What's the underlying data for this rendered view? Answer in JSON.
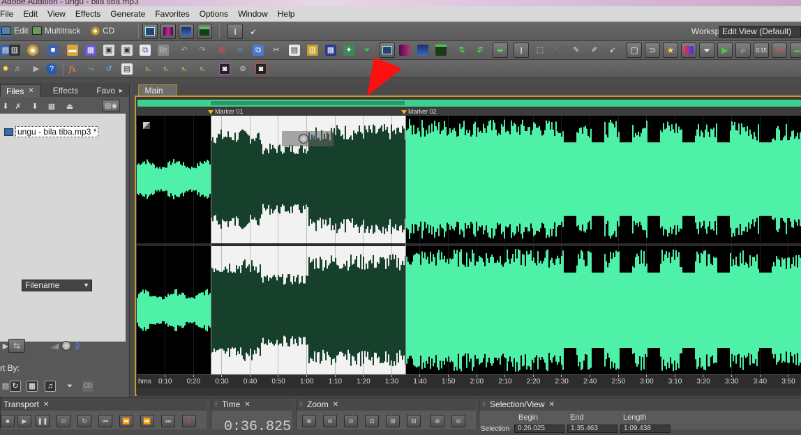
{
  "window": {
    "title": "Adobe Audition - ungu - bila tiba.mp3"
  },
  "menu": [
    "File",
    "Edit",
    "View",
    "Effects",
    "Generate",
    "Favorites",
    "Options",
    "Window",
    "Help"
  ],
  "modes": {
    "edit": "Edit",
    "multitrack": "Multitrack",
    "cd": "CD"
  },
  "workspace": {
    "label": "Workspace:",
    "value": "Edit View (Default)"
  },
  "left_panel": {
    "tabs": [
      "Files",
      "Effects",
      "Favo"
    ],
    "files": [
      {
        "name": "ungu - bila tiba.mp3 *"
      }
    ],
    "sort_by_label": "rt By:",
    "sort_by_value": "Filename",
    "volume_value": "0"
  },
  "main": {
    "tab_label": "Main",
    "markers": [
      "Marker 01",
      "Marker 02"
    ],
    "gain_readout": "0",
    "ruler": {
      "unit": "hms",
      "labels": [
        "0:10",
        "0:20",
        "0:30",
        "0:40",
        "0:50",
        "1:00",
        "1:10",
        "1:20",
        "1:30",
        "1:40",
        "1:50",
        "2:00",
        "2:10",
        "2:20",
        "2:30",
        "2:40",
        "2:50",
        "3:00",
        "3:10",
        "3:20",
        "3:30",
        "3:40",
        "3:50"
      ]
    }
  },
  "bottom": {
    "transport": {
      "label": "Transport"
    },
    "time": {
      "label": "Time",
      "value": "0:36.825"
    },
    "zoom": {
      "label": "Zoom"
    },
    "selection_view": {
      "label": "Selection/View",
      "columns": [
        "Begin",
        "End",
        "Length"
      ],
      "row_label": "Selection",
      "values": [
        "0:26.025",
        "1:35.463",
        "1:09.438"
      ]
    }
  },
  "colors": {
    "waveform": "#4ff0a8",
    "waveform_selected": "#16402c",
    "selection_bg": "#f2f2f2",
    "marker": "#e8b320",
    "accent_frame": "#c99a2a",
    "arrow": "#ff1010"
  }
}
